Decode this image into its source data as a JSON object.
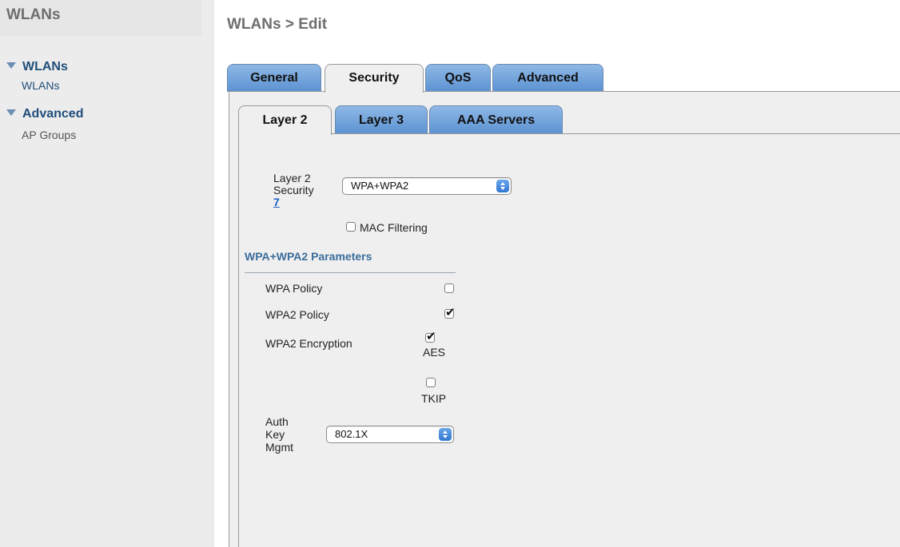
{
  "sidebar": {
    "title": "WLANs",
    "sections": [
      {
        "label": "WLANs",
        "items": [
          "WLANs"
        ]
      },
      {
        "label": "Advanced",
        "items": [
          "AP Groups"
        ]
      }
    ]
  },
  "page": {
    "title": "WLANs > Edit"
  },
  "tabs": [
    {
      "label": "General",
      "active": false
    },
    {
      "label": "Security",
      "active": true
    },
    {
      "label": "QoS",
      "active": false
    },
    {
      "label": "Advanced",
      "active": false
    }
  ],
  "subtabs": [
    {
      "label": "Layer 2",
      "active": true
    },
    {
      "label": "Layer 3",
      "active": false
    },
    {
      "label": "AAA Servers",
      "active": false
    }
  ],
  "layer2": {
    "security_label_1": "Layer 2",
    "security_label_2": "Security",
    "help_link": "7",
    "security_value": "WPA+WPA2",
    "mac_filtering_label": "MAC Filtering",
    "mac_filtering_checked": false
  },
  "wpa": {
    "section_title": "WPA+WPA2 Parameters",
    "wpa_policy_label": "WPA Policy",
    "wpa_policy_checked": false,
    "wpa2_policy_label": "WPA2 Policy",
    "wpa2_policy_checked": true,
    "wpa2_encryption_label": "WPA2 Encryption",
    "aes_label": "AES",
    "aes_checked": true,
    "tkip_label": "TKIP",
    "tkip_checked": false,
    "auth_label_1": "Auth",
    "auth_label_2": "Key",
    "auth_label_3": "Mgmt",
    "auth_value": "802.1X"
  },
  "colors": {
    "tab_blue": "#5c93d2",
    "link": "#1c5fbf",
    "section_head": "#3a6d9a"
  }
}
